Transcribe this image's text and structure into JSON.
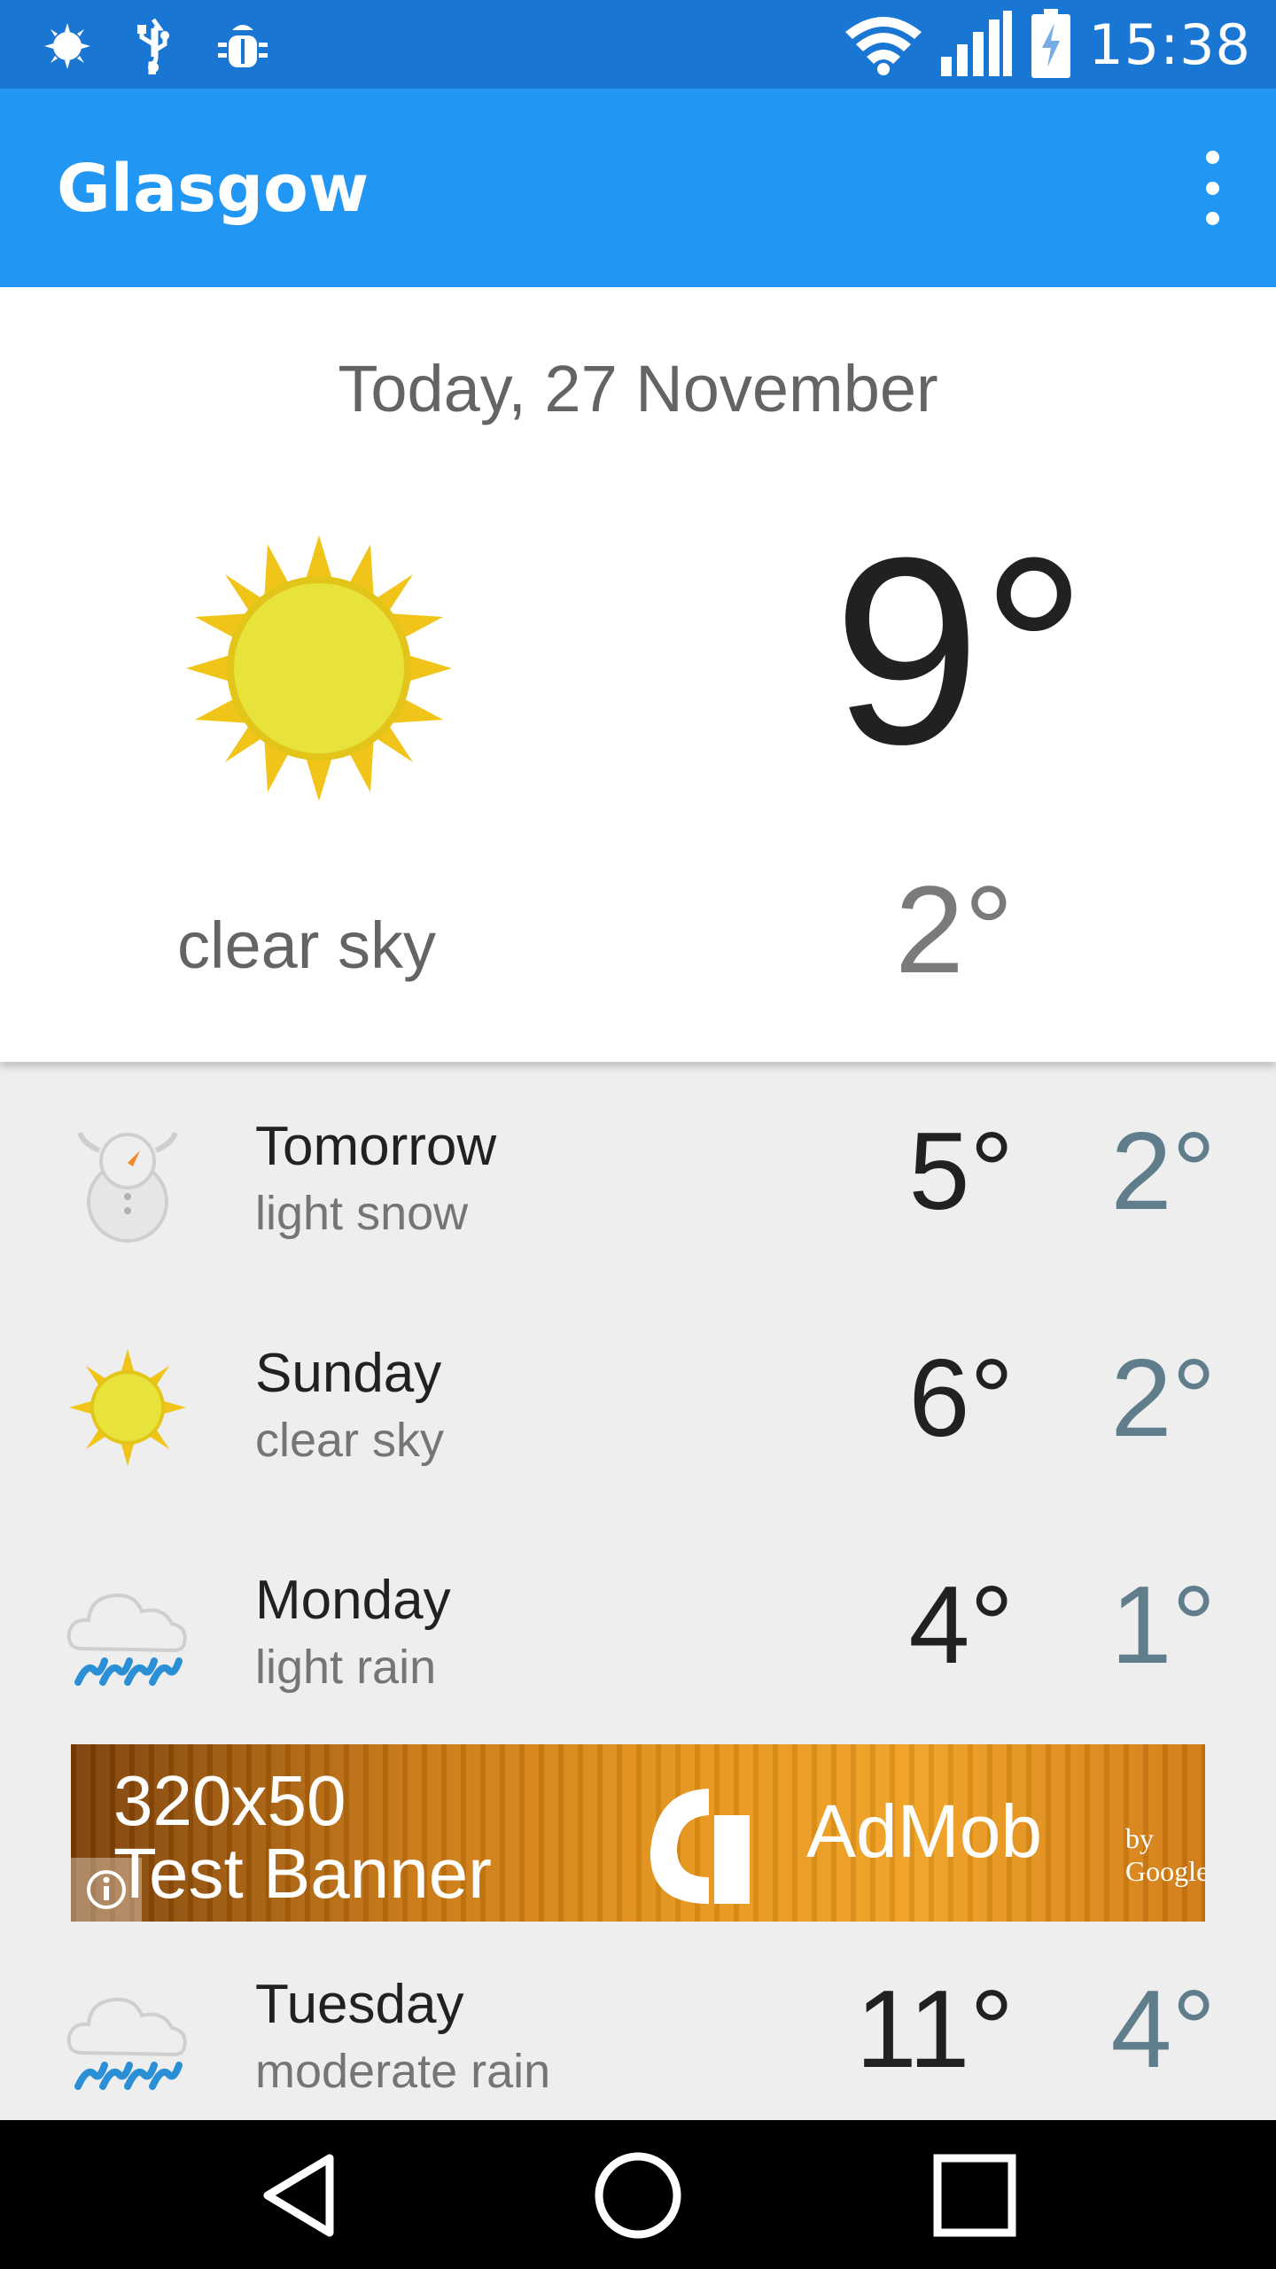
{
  "status_bar": {
    "time": "15:38",
    "icons": [
      "weather-notification-icon",
      "usb-icon",
      "debug-icon",
      "wifi-icon",
      "signal-icon",
      "battery-charging-icon"
    ]
  },
  "app_bar": {
    "title": "Glasgow",
    "menu_icon": "more-vert-icon"
  },
  "today": {
    "date": "Today, 27 November",
    "high": "9°",
    "low": "2°",
    "description": "clear sky",
    "icon": "sun-icon"
  },
  "forecast": [
    {
      "day": "Tomorrow",
      "description": "light snow",
      "high": "5°",
      "low": "2°",
      "icon": "snowman-icon"
    },
    {
      "day": "Sunday",
      "description": "clear sky",
      "high": "6°",
      "low": "2°",
      "icon": "sun-icon"
    },
    {
      "day": "Monday",
      "description": "light rain",
      "high": "4°",
      "low": "1°",
      "icon": "rain-cloud-icon"
    },
    {
      "day": "Tuesday",
      "description": "moderate rain",
      "high": "11°",
      "low": "4°",
      "icon": "rain-cloud-icon"
    }
  ],
  "ad": {
    "line1": "320x50",
    "line2": "Test Banner",
    "brand": "AdMob",
    "by": "by Google"
  },
  "nav": {
    "icons": [
      "back-icon",
      "home-icon",
      "recents-icon"
    ]
  },
  "colors": {
    "status_bar": "#1976d2",
    "app_bar": "#2196f3",
    "low_temp": "#607d8b",
    "list_bg": "#eeeeee"
  }
}
